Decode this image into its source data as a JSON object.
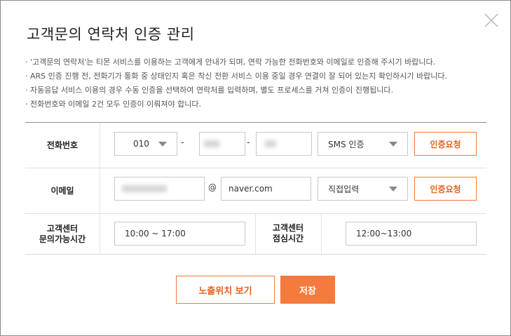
{
  "dialog": {
    "title": "고객문의 연락처 인증 관리",
    "close_icon": "close-icon"
  },
  "notes": [
    "· '고객문의 연락처'는 티몬 서비스를 이용하는 고객에게 안내가 되며, 연락 가능한 전화번호와 이메일로 인증해 주시기 바랍니다.",
    "· ARS 인증 진행 전, 전화기가 통화 중 상태인지 혹은 착신 전환 서비스 이용 중일 경우 연결이 잘 되어 있는지 확인하시기 바랍니다.",
    "· 자동응답 서비스 이용의 경우 수동 인증을 선택하여 연락처를 입력하며, 별도 프로세스를 거쳐 인증이 진행됩니다.",
    "· 전화번호와 이메일 2건 모두 인증이 이뤄져야 합니다."
  ],
  "phone": {
    "label": "전화번호",
    "prefix": "010",
    "separator": "-",
    "auth_method": "SMS 인증",
    "auth_button": "인증요청"
  },
  "email": {
    "label": "이메일",
    "at": "@",
    "domain": "naver.com",
    "domain_select": "직접입력",
    "auth_button": "인증요청"
  },
  "hours": {
    "inquiry_label_line1": "고객센터",
    "inquiry_label_line2": "문의가능시간",
    "inquiry_value": "10:00 ~ 17:00",
    "lunch_label_line1": "고객센터",
    "lunch_label_line2": "점심시간",
    "lunch_value": "12:00~13:00"
  },
  "actions": {
    "preview_label": "노출위치 보기",
    "save_label": "저장"
  },
  "colors": {
    "accent": "#f47b3d",
    "accent_text": "#e2611d"
  }
}
